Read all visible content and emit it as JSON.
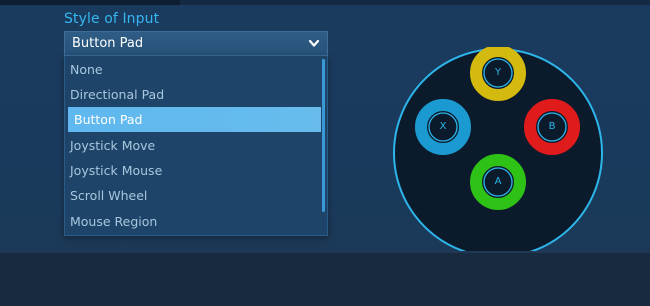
{
  "style_of_input": {
    "label": "Style of Input",
    "selected_value": "Button Pad",
    "options": [
      "None",
      "Directional Pad",
      "Button Pad",
      "Joystick Move",
      "Joystick Mouse",
      "Scroll Wheel",
      "Mouse Region"
    ],
    "selected_index": 2
  },
  "button_pad": {
    "buttons": {
      "y": {
        "letter": "Y",
        "color": "#d4b90e"
      },
      "x": {
        "letter": "X",
        "color": "#1b9ad1"
      },
      "b": {
        "letter": "B",
        "color": "#e01b1b"
      },
      "a": {
        "letter": "A",
        "color": "#2ec116"
      }
    },
    "outline_color": "#2db5ea"
  },
  "theme": {
    "accent": "#35b7ef",
    "highlight": "#62b9ee",
    "background": "#1a3a5e"
  }
}
